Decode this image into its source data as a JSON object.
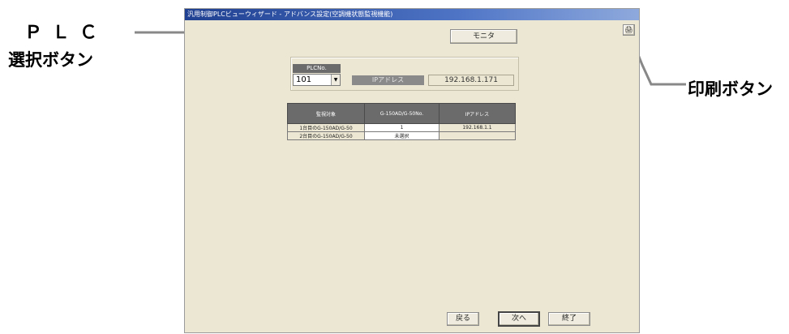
{
  "callouts": {
    "plc_line1": "ＰＬＣ",
    "plc_line2": "選択ボタン",
    "print": "印刷ボタン"
  },
  "window": {
    "title": "汎用制御PLCビューウィザード - アドバンス設定(空調機状態監視機能)"
  },
  "toolbar": {
    "monitor_label": "モニタ",
    "print_icon": "printer-icon"
  },
  "plc": {
    "label": "PLCNo.",
    "selected": "101",
    "ip_label": "IPアドレス",
    "ip_value": "192.168.1.171"
  },
  "table": {
    "headers": [
      "監視対象",
      "G-150AD/G-50No.",
      "IPアドレス"
    ],
    "rows": [
      {
        "target": "1台目のG-150AD/G-50",
        "number": "1",
        "ip": "192.168.1.1"
      },
      {
        "target": "2台目のG-150AD/G-50",
        "number": "未選択",
        "ip": ""
      }
    ]
  },
  "footer": {
    "back_label": "戻る",
    "next_label": "次へ",
    "finish_label": "終了"
  }
}
